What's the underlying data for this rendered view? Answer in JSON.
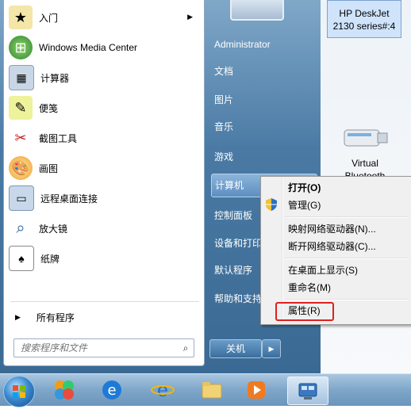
{
  "desktop": {
    "printer_label": "HP DeskJet 2130 series#:4",
    "usb_label": "Virtual Bluetooth"
  },
  "start_menu": {
    "programs": [
      {
        "label": "入门",
        "icon": "getting-started-icon",
        "has_arrow": true
      },
      {
        "label": "Windows Media Center",
        "icon": "media-center-icon",
        "has_arrow": false
      },
      {
        "label": "计算器",
        "icon": "calculator-icon",
        "has_arrow": false
      },
      {
        "label": "便笺",
        "icon": "sticky-notes-icon",
        "has_arrow": false
      },
      {
        "label": "截图工具",
        "icon": "snipping-tool-icon",
        "has_arrow": false
      },
      {
        "label": "画图",
        "icon": "paint-icon",
        "has_arrow": false
      },
      {
        "label": "远程桌面连接",
        "icon": "remote-desktop-icon",
        "has_arrow": false
      },
      {
        "label": "放大镜",
        "icon": "magnifier-icon",
        "has_arrow": false
      },
      {
        "label": "纸牌",
        "icon": "solitaire-icon",
        "has_arrow": false
      }
    ],
    "all_programs": "所有程序",
    "search_placeholder": "搜索程序和文件",
    "right_items": [
      {
        "label": "Administrator"
      },
      {
        "label": "文档"
      },
      {
        "label": "图片"
      },
      {
        "label": "音乐"
      },
      {
        "label": "游戏"
      },
      {
        "label": "计算机"
      },
      {
        "label": "控制面板"
      },
      {
        "label": "设备和打印"
      },
      {
        "label": "默认程序"
      },
      {
        "label": "帮助和支持"
      }
    ],
    "shutdown_label": "关机"
  },
  "context_menu": {
    "items": [
      {
        "label": "打开(O)",
        "bold": true
      },
      {
        "label": "管理(G)",
        "bold": false,
        "icon": "uac-shield-icon"
      },
      {
        "label": "映射网络驱动器(N)...",
        "bold": false
      },
      {
        "label": "断开网络驱动器(C)...",
        "bold": false
      },
      {
        "label": "在桌面上显示(S)",
        "bold": false
      },
      {
        "label": "重命名(M)",
        "bold": false
      },
      {
        "label": "属性(R)",
        "bold": false
      }
    ],
    "highlight_color": "#e02020"
  },
  "taskbar": {
    "colors": {
      "accent": "#3a8ad0"
    }
  }
}
